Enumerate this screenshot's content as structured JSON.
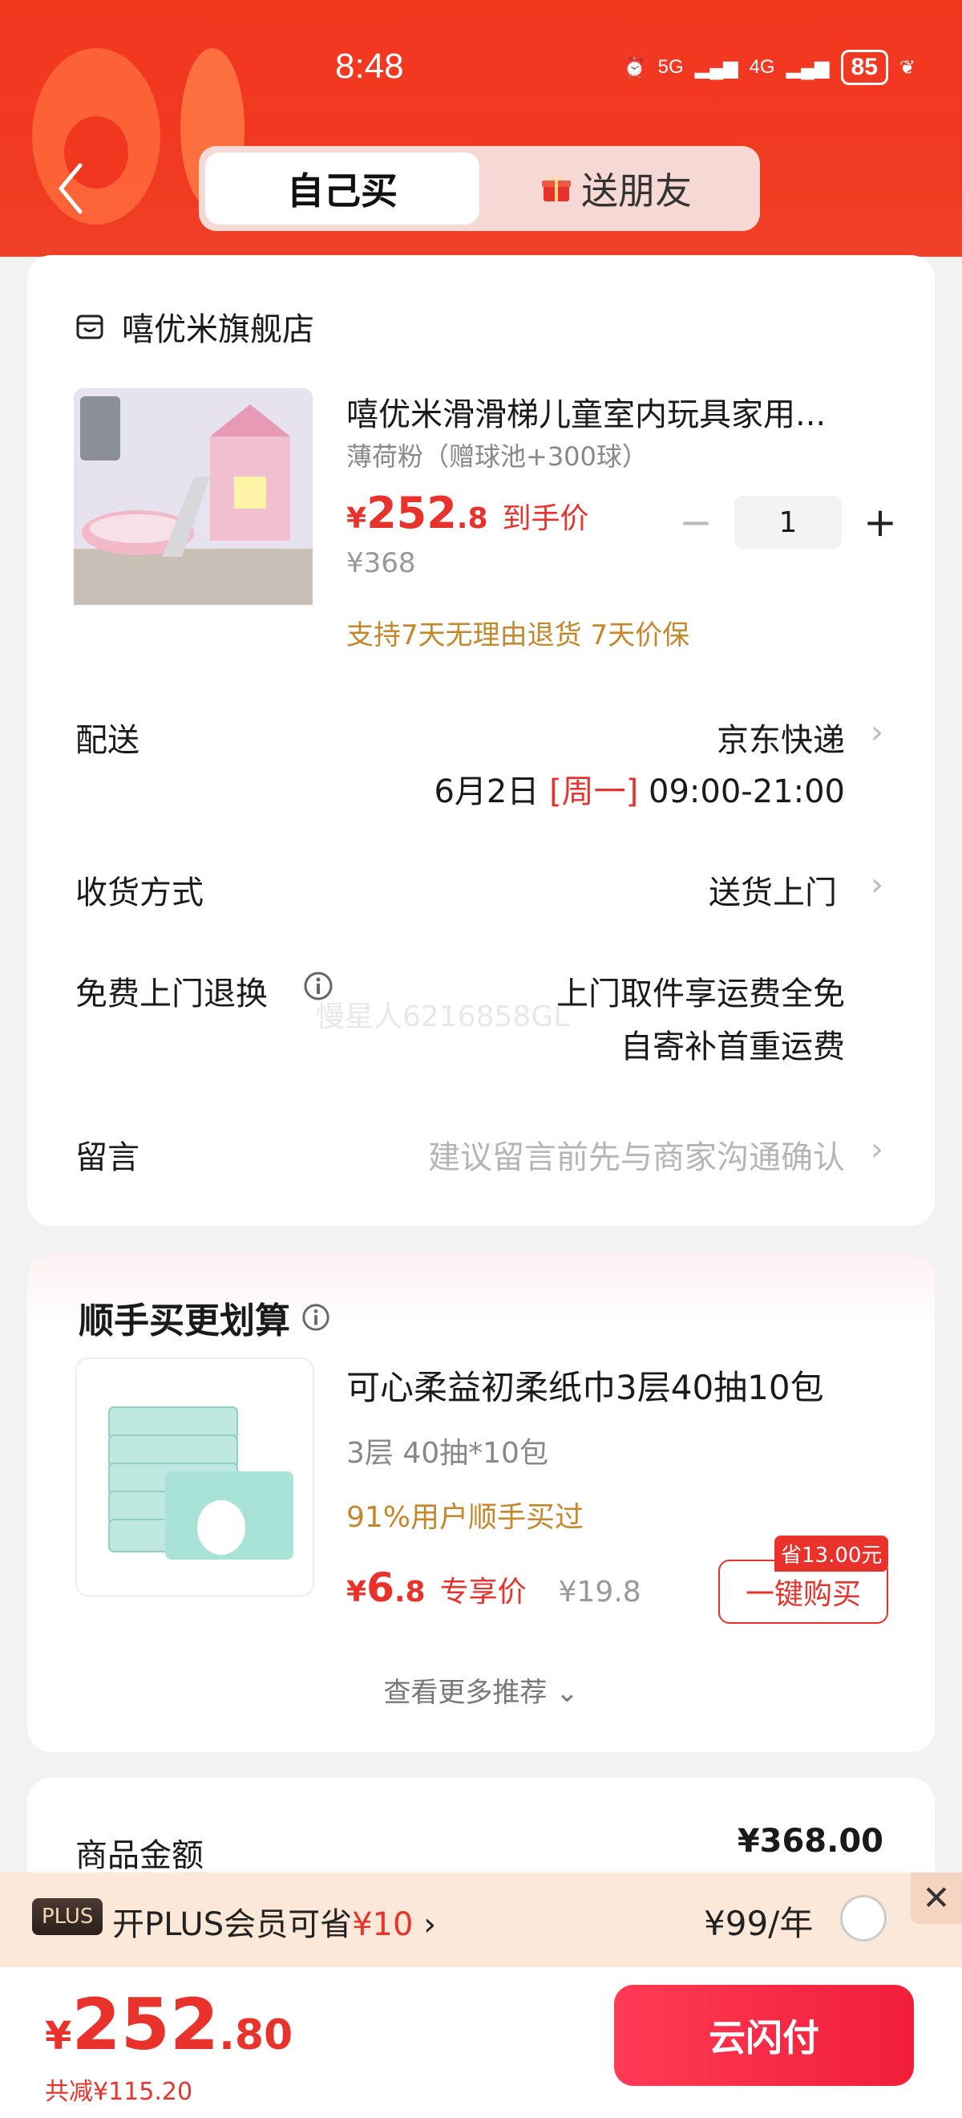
{
  "status_bar": {
    "time": "8:48",
    "signal1": "5G",
    "signal2": "4G",
    "battery": "85"
  },
  "tabs": [
    {
      "label": "自己买"
    },
    {
      "label": "送朋友"
    }
  ],
  "store": {
    "name": "嘻优米旗舰店"
  },
  "product": {
    "title": "嘻优米滑滑梯儿童室内玩具家用...",
    "spec": "薄荷粉（赠球池+300球）",
    "price_yen": "¥",
    "price_int": "252",
    "price_dec": ".8",
    "price_tag": "到手价",
    "original_price": "¥368",
    "quantity": "1",
    "guarantee": "支持7天无理由退货  7天价保"
  },
  "delivery": {
    "label": "配送",
    "carrier": "京东快递",
    "date": "6月2日",
    "weekday": "[周一]",
    "time": "09:00-21:00"
  },
  "receive": {
    "label": "收货方式",
    "value": "送货上门"
  },
  "return": {
    "label": "免费上门退换",
    "line1": "上门取件享运费全免",
    "line2": "自寄补首重运费"
  },
  "watermark": "慢星人6216858GL",
  "message": {
    "label": "留言",
    "placeholder": "建议留言前先与商家沟通确认"
  },
  "recommend": {
    "title": "顺手买更划算",
    "name": "可心柔益初柔纸巾3层40抽10包",
    "spec": "3层 40抽*10包",
    "bought": "91%用户顺手买过",
    "price_yen": "¥",
    "price_int": "6",
    "price_dec": ".8",
    "price_tag": "专享价",
    "original_price": "¥19.8",
    "save_badge": "省13.00元",
    "buy_label": "一键购买",
    "more_label": "查看更多推荐 ⌄"
  },
  "summary": {
    "label": "商品金额",
    "value": "¥368.00"
  },
  "plus": {
    "badge": "PLUS",
    "text_prefix": "开PLUS会员可省",
    "text_amount": "¥10",
    "price": "¥99/年"
  },
  "footer": {
    "total_yen": "¥",
    "total_int": "252",
    "total_dec": ".80",
    "discount": "共减¥115.20",
    "pay_label": "云闪付"
  },
  "colors": {
    "brand_red": "#e8322b",
    "header_red": "#f2371f",
    "gold": "#c6862a"
  }
}
